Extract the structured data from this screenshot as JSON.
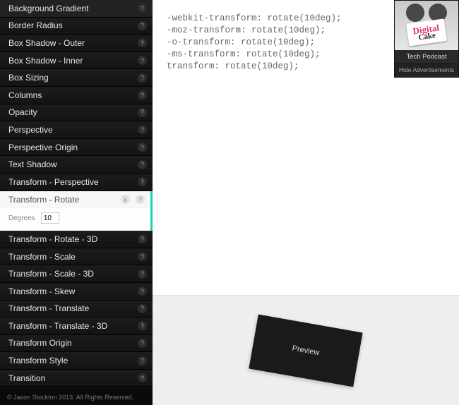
{
  "sidebar": {
    "items": [
      {
        "label": "Background Gradient"
      },
      {
        "label": "Border Radius"
      },
      {
        "label": "Box Shadow - Outer"
      },
      {
        "label": "Box Shadow - Inner"
      },
      {
        "label": "Box Sizing"
      },
      {
        "label": "Columns"
      },
      {
        "label": "Opacity"
      },
      {
        "label": "Perspective"
      },
      {
        "label": "Perspective Origin"
      },
      {
        "label": "Text Shadow"
      },
      {
        "label": "Transform - Perspective"
      },
      {
        "label": "Transform - Rotate",
        "active": true
      },
      {
        "label": "Transform - Rotate - 3D"
      },
      {
        "label": "Transform - Scale"
      },
      {
        "label": "Transform - Scale - 3D"
      },
      {
        "label": "Transform - Skew"
      },
      {
        "label": "Transform - Translate"
      },
      {
        "label": "Transform - Translate - 3D"
      },
      {
        "label": "Transform Origin"
      },
      {
        "label": "Transform Style"
      },
      {
        "label": "Transition"
      }
    ],
    "active_panel": {
      "degrees_label": "Degrees",
      "degrees_value": "10"
    },
    "footer": "© Jason Stockton 2013. All Rights Reserved."
  },
  "code": {
    "lines": [
      "-webkit-transform: rotate(10deg);",
      "-moz-transform: rotate(10deg);",
      "-o-transform: rotate(10deg);",
      "-ms-transform: rotate(10deg);",
      "transform: rotate(10deg);"
    ]
  },
  "preview": {
    "label": "Preview"
  },
  "ad": {
    "logo_top": "Digital",
    "logo_bottom": "Cake",
    "caption": "Tech Podcast",
    "hide_label": "Hide Advertisements"
  },
  "glyphs": {
    "help": "?",
    "reset": "x"
  }
}
